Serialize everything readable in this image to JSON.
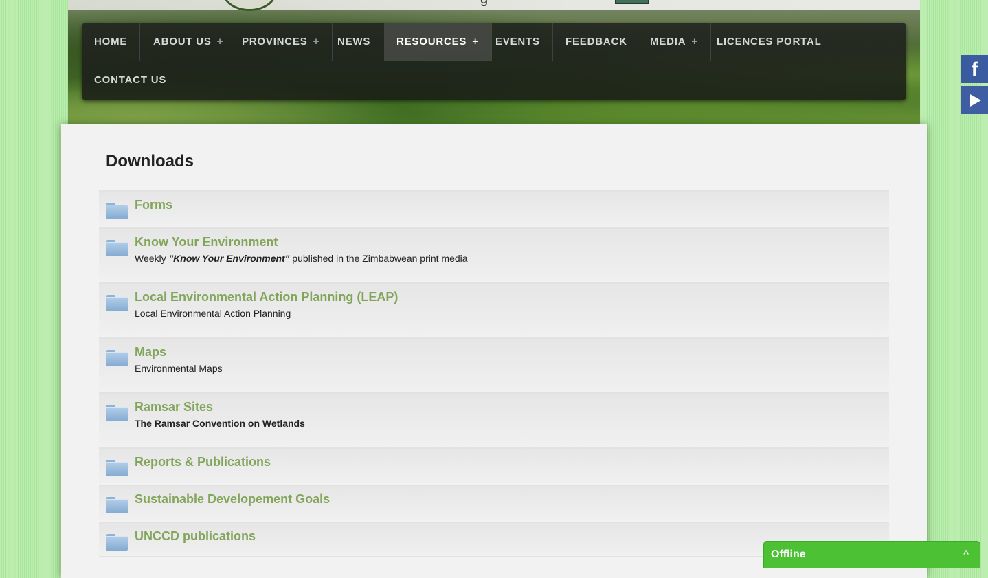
{
  "nav": {
    "items": [
      {
        "label": "HOME",
        "has_submenu": false,
        "active": false
      },
      {
        "label": "ABOUT US",
        "has_submenu": true,
        "active": false
      },
      {
        "label": "PROVINCES",
        "has_submenu": true,
        "active": false
      },
      {
        "label": "NEWS",
        "has_submenu": false,
        "active": false
      },
      {
        "label": "RESOURCES",
        "has_submenu": true,
        "active": true
      },
      {
        "label": "EVENTS",
        "has_submenu": false,
        "active": false
      },
      {
        "label": "FEEDBACK",
        "has_submenu": false,
        "active": false
      },
      {
        "label": "MEDIA",
        "has_submenu": true,
        "active": false
      },
      {
        "label": "LICENCES PORTAL",
        "has_submenu": false,
        "active": false
      },
      {
        "label": "CONTACT US",
        "has_submenu": false,
        "active": false
      }
    ],
    "submenu_glyph": "+"
  },
  "header": {
    "partial_text": "g"
  },
  "social": {
    "facebook_label": "f",
    "youtube_icon": "play-icon"
  },
  "page": {
    "title": "Downloads"
  },
  "categories": [
    {
      "title": "Forms",
      "description": ""
    },
    {
      "title": "Know Your Environment",
      "desc_before": "Weekly ",
      "desc_emphasis": "\"Know Your Environment\"",
      "desc_after": " published in the Zimbabwean print media"
    },
    {
      "title": "Local Environmental Action Planning (LEAP)",
      "description": "Local Environmental Action Planning"
    },
    {
      "title": "Maps",
      "description": "Environmental Maps"
    },
    {
      "title": "Ramsar Sites",
      "description": "The Ramsar Convention on Wetlands"
    },
    {
      "title": "Reports & Publications",
      "description": ""
    },
    {
      "title": "Sustainable Developement Goals",
      "description": ""
    },
    {
      "title": "UNCCD publications",
      "description": ""
    }
  ],
  "chat": {
    "status": "Offline",
    "toggle_glyph": "^"
  },
  "colors": {
    "accent_green": "#82a55b",
    "chat_green": "#4cc133",
    "social_blue": "#3b5ba1",
    "nav_bg": "#23261f"
  }
}
